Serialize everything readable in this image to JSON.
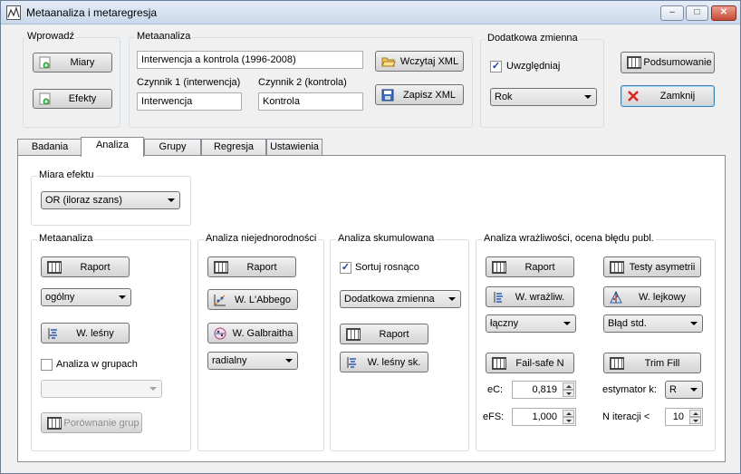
{
  "window": {
    "title": "Metaanaliza i metaregresja",
    "min": "–",
    "max": "□",
    "close": "✕"
  },
  "input_group": {
    "label": "Wprowadź",
    "measures": "Miary",
    "effects": "Efekty"
  },
  "meta": {
    "label": "Metaanaliza",
    "title_value": "Interwencja a kontrola (1996-2008)",
    "factor1_label": "Czynnik 1 (interwencja)",
    "factor1_value": "Interwencja",
    "factor2_label": "Czynnik 2 (kontrola)",
    "factor2_value": "Kontrola",
    "load_xml": "Wczytaj XML",
    "save_xml": "Zapisz XML"
  },
  "extra": {
    "label": "Dodatkowa zmienna",
    "include_label": "Uwzględniaj",
    "include_checked": true,
    "variable": "Rok"
  },
  "actions": {
    "summary": "Podsumowanie",
    "close": "Zamknij"
  },
  "tabs": [
    "Badania",
    "Analiza",
    "Grupy",
    "Regresja",
    "Ustawienia"
  ],
  "active_tab": "Analiza",
  "effect": {
    "label": "Miara efektu",
    "value": "OR (iloraz szans)"
  },
  "meta_panel": {
    "label": "Metaanaliza",
    "report": "Raport",
    "type": "ogólny",
    "forest": "W. leśny",
    "group_check": "Analiza w grupach",
    "group_check_checked": false,
    "group_select": "",
    "compare": "Porównanie grup"
  },
  "hetero": {
    "label": "Analiza niejednorodności",
    "report": "Raport",
    "labbe": "W. L'Abbego",
    "galbraith": "W. Galbraitha",
    "galbraith_type": "radialny"
  },
  "cumulative": {
    "label": "Analiza skumulowana",
    "sort_label": "Sortuj rosnąco",
    "sort_checked": true,
    "sort_by": "Dodatkowa zmienna",
    "report": "Raport",
    "forest": "W. leśny sk."
  },
  "sensitivity": {
    "label": "Analiza wrażliwości, ocena błędu publ.",
    "report": "Raport",
    "asym": "Testy asymetrii",
    "sens_plot": "W. wrażliw.",
    "funnel": "W. lejkowy",
    "sens_type": "łączny",
    "funnel_type": "Błąd std.",
    "failsafe": "Fail-safe N",
    "trimfill": "Trim Fill",
    "ec_label": "eC:",
    "ec_value": "0,819",
    "efs_label": "eFS:",
    "efs_value": "1,000",
    "estimator_label": "estymator k:",
    "estimator_value": "R",
    "iter_label": "N iteracji <",
    "iter_value": "10"
  }
}
